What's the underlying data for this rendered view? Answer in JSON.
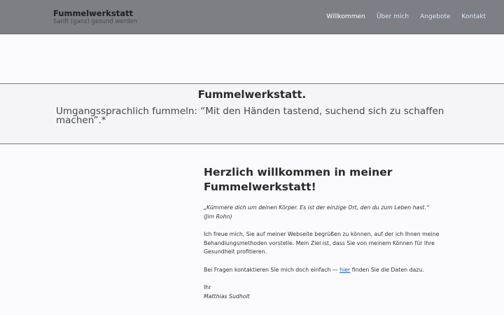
{
  "header": {
    "site_title": "Fummelwerkstatt",
    "tagline": "Sanft (ganz) gesund werden",
    "nav": [
      {
        "label": "Willkommen"
      },
      {
        "label": "Über mich"
      },
      {
        "label": "Angebote"
      },
      {
        "label": "Kontakt"
      }
    ],
    "active_nav": "Willkommen"
  },
  "hero": {
    "title": "Fummelwerkstatt.",
    "definition": "Umgangssprachlich fummeln: “Mit den Händen tastend, suchend sich zu schaffen machen”.*"
  },
  "main": {
    "heading": "Herzlich willkommen in meiner Fummelwerkstatt!",
    "quote": "„Kümmere dich um deinen Körper. Es ist der einzige Ort, den du zum Leben hast.“",
    "quote_author": "(Jim Rohn)",
    "intro": "Ich freue mich, Sie auf meiner Webseite begrüßen zu können, auf der ich Ihnen meine Behandlungsmethoden vorstelle. Mein Ziel ist, dass Sie von meinem Können für Ihre Gesundheit profitieren.",
    "contact_before": "Bei Fragen kontaktieren Sie mich doch einfach — ",
    "contact_link": "hier",
    "contact_after": " finden Sie die Daten dazu.",
    "closing": "Ihr",
    "signature": "Matthias Sudholt"
  },
  "colors": {
    "header_bg": "#7d7f84",
    "link": "#1d5dbd",
    "nav_link": "#d7e6ff"
  }
}
